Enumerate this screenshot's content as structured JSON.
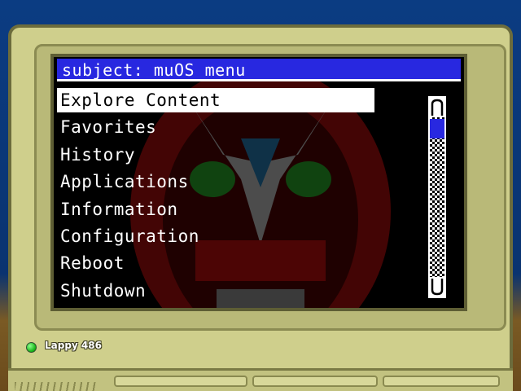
{
  "window": {
    "title": "subject: muOS menu"
  },
  "menu": {
    "items": [
      {
        "label": "Explore Content",
        "selected": true
      },
      {
        "label": "Favorites",
        "selected": false
      },
      {
        "label": "History",
        "selected": false
      },
      {
        "label": "Applications",
        "selected": false
      },
      {
        "label": "Information",
        "selected": false
      },
      {
        "label": "Configuration",
        "selected": false
      },
      {
        "label": "Reboot",
        "selected": false
      },
      {
        "label": "Shutdown",
        "selected": false
      }
    ]
  },
  "device": {
    "brand": "Lappy 486",
    "led_color": "#22cc22"
  },
  "colors": {
    "title_bar": "#2828e0",
    "selection": "#ffffff",
    "scroll_thumb": "#2828e0",
    "bezel": "#cfcf8c"
  },
  "scrollbar": {
    "position_fraction": 0.0
  },
  "icons": {
    "scroll_up": "up-arrow-icon",
    "scroll_down": "down-arrow-icon",
    "led": "power-led-icon"
  }
}
